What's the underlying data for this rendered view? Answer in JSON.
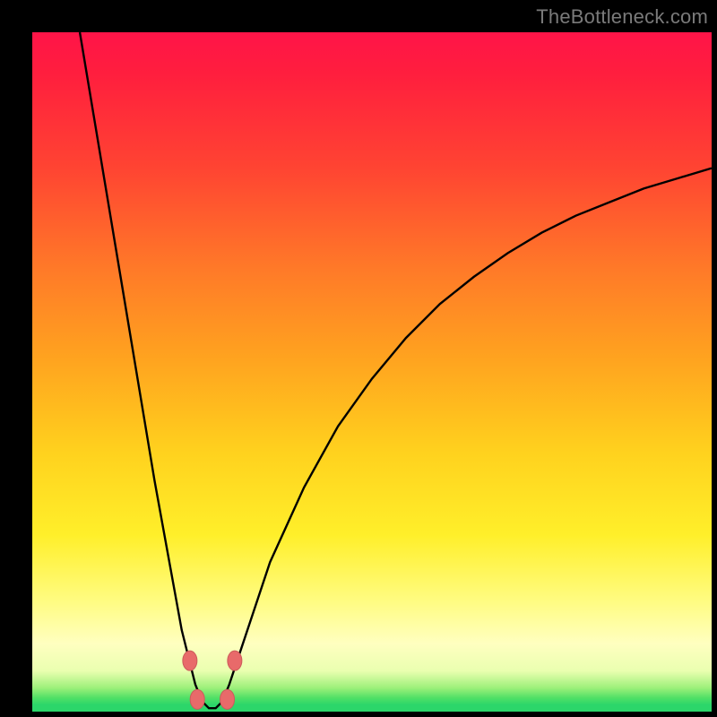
{
  "watermark": {
    "text": "TheBottleneck.com"
  },
  "colors": {
    "frame_background": "#000000",
    "gradient_top": "#ff1448",
    "gradient_mid": "#ffd21e",
    "gradient_bottom": "#2cd66a",
    "curve_stroke": "#000000",
    "marker_fill": "#e86a6a",
    "marker_stroke": "#cc5a5a",
    "watermark_text": "#7a7a7a"
  },
  "chart_data": {
    "type": "line",
    "title": "",
    "xlabel": "",
    "ylabel": "",
    "xlim": [
      0,
      100
    ],
    "ylim": [
      0,
      100
    ],
    "grid": false,
    "legend": false,
    "annotations": [],
    "description": "Bottleneck-style V-shaped curve on a vertical red→yellow→green heat gradient. Curve apex (minimum) sits near x≈26 at y≈0. Left branch rises steeply to y=100 at x≈7; right branch rises asymptotically toward y≈80 at x=100. Four salmon-colored markers highlight the near-minimum region.",
    "series": [
      {
        "name": "curve",
        "x": [
          7,
          10,
          13,
          16,
          18,
          20,
          22,
          23,
          24,
          25,
          26,
          27,
          28,
          29,
          30,
          32,
          35,
          40,
          45,
          50,
          55,
          60,
          65,
          70,
          75,
          80,
          85,
          90,
          95,
          100
        ],
        "y": [
          100,
          82,
          64,
          46,
          34,
          23,
          12,
          8,
          4,
          1.5,
          0.5,
          0.5,
          1.5,
          4,
          7,
          13,
          22,
          33,
          42,
          49,
          55,
          60,
          64,
          67.5,
          70.5,
          73,
          75,
          77,
          78.5,
          80
        ]
      }
    ],
    "markers": [
      {
        "x": 23.2,
        "y": 7.5
      },
      {
        "x": 29.8,
        "y": 7.5
      },
      {
        "x": 24.3,
        "y": 1.8
      },
      {
        "x": 28.7,
        "y": 1.8
      }
    ]
  }
}
